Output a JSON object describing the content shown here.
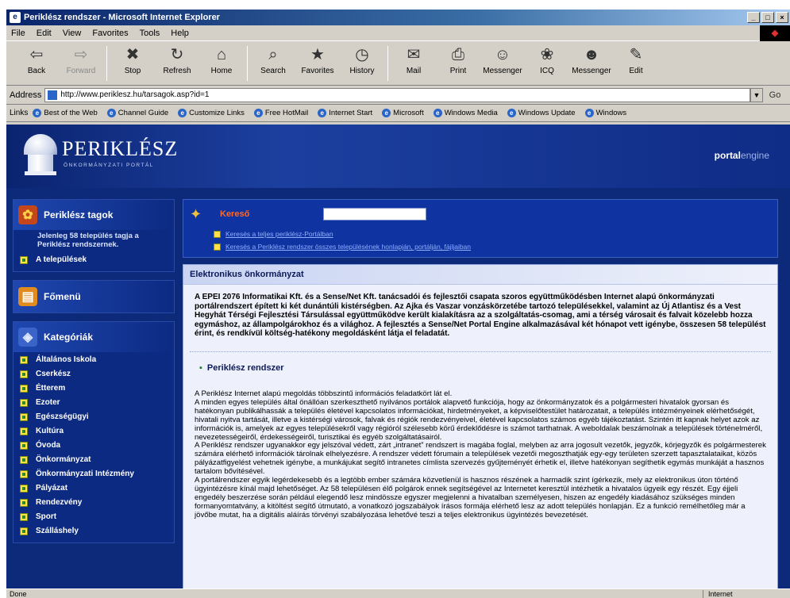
{
  "window": {
    "title": "Periklész rendszer - Microsoft Internet Explorer",
    "buttons": [
      "_",
      "□",
      "×"
    ]
  },
  "menu": [
    "File",
    "Edit",
    "View",
    "Favorites",
    "Tools",
    "Help"
  ],
  "toolbar": [
    {
      "label": "Back",
      "icon": "back-arrow-icon",
      "glyph": "⇦"
    },
    {
      "label": "Forward",
      "icon": "forward-arrow-icon",
      "glyph": "⇨"
    },
    {
      "label": "Stop",
      "icon": "stop-icon",
      "glyph": "✖"
    },
    {
      "label": "Refresh",
      "icon": "refresh-icon",
      "glyph": "↻"
    },
    {
      "label": "Home",
      "icon": "home-icon",
      "glyph": "⌂"
    },
    {
      "label": "Search",
      "icon": "search-icon",
      "glyph": "⌕"
    },
    {
      "label": "Favorites",
      "icon": "favorites-icon",
      "glyph": "★"
    },
    {
      "label": "History",
      "icon": "history-icon",
      "glyph": "◷"
    },
    {
      "label": "Mail",
      "icon": "mail-icon",
      "glyph": "✉"
    },
    {
      "label": "Print",
      "icon": "print-icon",
      "glyph": "⎙"
    },
    {
      "label": "Messenger",
      "icon": "messenger-icon",
      "glyph": "☺"
    },
    {
      "label": "ICQ",
      "icon": "icq-icon",
      "glyph": "❀"
    },
    {
      "label": "Messenger",
      "icon": "messenger-2-icon",
      "glyph": "☻"
    },
    {
      "label": "Edit",
      "icon": "edit-icon",
      "glyph": "✎"
    }
  ],
  "address": {
    "label": "Address",
    "url": "http://www.periklesz.hu/tarsagok.asp?id=1",
    "go": "Go"
  },
  "links": {
    "label": "Links",
    "items": [
      "Best of the Web",
      "Channel Guide",
      "Customize Links",
      "Free HotMail",
      "Internet Start",
      "Microsoft",
      "Windows Media",
      "Windows Update",
      "Windows"
    ]
  },
  "site": {
    "brand": "PERIKLÉSZ",
    "subbrand": "ÖNKORMÁNYZATI PORTÁL",
    "portal_a": "portal",
    "portal_b": "engine"
  },
  "sidebar": {
    "members_title": "Periklész tagok",
    "members_text": "Jelenleg 58 település tagja a Periklész rendszernek.",
    "members_link": "A települések",
    "home_title": "Főmenü",
    "categories_title": "Kategóriák",
    "categories": [
      "Általános Iskola",
      "Cserkész",
      "Étterem",
      "Ezoter",
      "Egészségügyi",
      "Kultúra",
      "Óvoda",
      "Önkormányzat",
      "Önkormányzati Intézmény",
      "Pályázat",
      "Rendezvény",
      "Sport",
      "Szálláshely"
    ]
  },
  "search": {
    "label": "Kereső",
    "placeholder": "",
    "link1": "Keresés a teljes periklész-Portálban",
    "link2": "Keresés a Periklész rendszer összes településének honlapján, portálján, fájljaiban"
  },
  "article": {
    "header": "Elektronikus önkormányzat",
    "lead": "A EPEI 2076 Informatikai Kft. és a Sense/Net Kft. tanácsadói és fejlesztői csapata szoros együttműködésben Internet alapú önkormányzati portálrendszert épített ki két dunántúli kistérségben. Az Ajka és Vaszar vonzáskörzetébe tartozó településekkel, valamint az Új Atlantisz és a Vest Hegyhát Térségi Fejlesztési Társulással együttműködve került kialakításra az a szolgáltatás-csomag, ami a térség városait és falvait közelebb hozza egymáshoz, az állampolgárokhoz és a világhoz. A fejlesztés a Sense/Net Portal Engine alkalmazásával két hónapot vett igénybe, összesen 58 települést érint, és rendkívül költség-hatékony megoldásként látja el feladatát.",
    "subhead": "Periklész rendszer",
    "paragraphs": [
      "A Periklész Internet alapú megoldás többszintű információs feladatkört lát el.",
      "A minden egyes település által önállóan szerkeszthető nyilvános portálok alapvető funkciója, hogy az önkormányzatok és a polgármesteri hivatalok gyorsan és hatékonyan publikálhassák a település életével kapcsolatos információkat, hirdetményeket, a képviselőtestület határozatait, a település intézményeinek elérhetőségét, hivatali nyitva tartását, illetve a kistérségi városok, falvak és régiók rendezvényeivel, életével kapcsolatos számos egyéb tájékoztatást. Szintén itt kapnak helyet azok az információk is, amelyek az egyes településekről vagy régióról szélesebb körű érdeklődésre is számot tarthatnak. A weboldalak beszámolnak a települések történelméről, nevezetességeiről, érdekességeiről, turisztikai és egyéb szolgáltatásairól.",
      "A Periklész rendszer ugyanakkor egy jelszóval védett, zárt „intranet” rendszert is magába foglal, melyben az arra jogosult vezetők, jegyzők, körjegyzők és polgármesterek számára elérhető információk tárolnak elhelyezésre. A rendszer védett fórumain a települések vezetői megoszthatják egy-egy területen szerzett tapasztalataikat, közös pályázatfigyelést vehetnek igénybe, a munkájukat segítő intranetes címlista szervezés gyűjteményét érhetik el, illetve hatékonyan segíthetik egymás munkáját a hasznos tartalom bővítésével.",
      "A portálrendszer egyik legérdekesebb és a legtöbb ember számára közvetlenül is hasznos részének a harmadik szint ígérkezik, mely az elektronikus úton történő ügyintézésre kínál majd lehetőséget. Az 58 településen élő polgárok ennek segítségével az Internetet keresztül intézhetik a hivatalos ügyeik egy részét. Egy éjjeli engedély beszerzése során például elegendő lesz mindössze egyszer megjelenni a hivatalban személyesen, hiszen az engedély kiadásához szükséges minden formanyomtatvány, a kitöltést segítő útmutató, a vonatkozó jogszabályok írásos formája elérhető lesz az adott település honlapján. Ez a funkció remélhetőleg már a jövőbe mutat, ha a digitális aláírás törvényi szabályozása lehetővé teszi a teljes elektronikus ügyintézés bevezetését."
    ]
  },
  "status": {
    "left": "Done",
    "zone": "Internet"
  }
}
